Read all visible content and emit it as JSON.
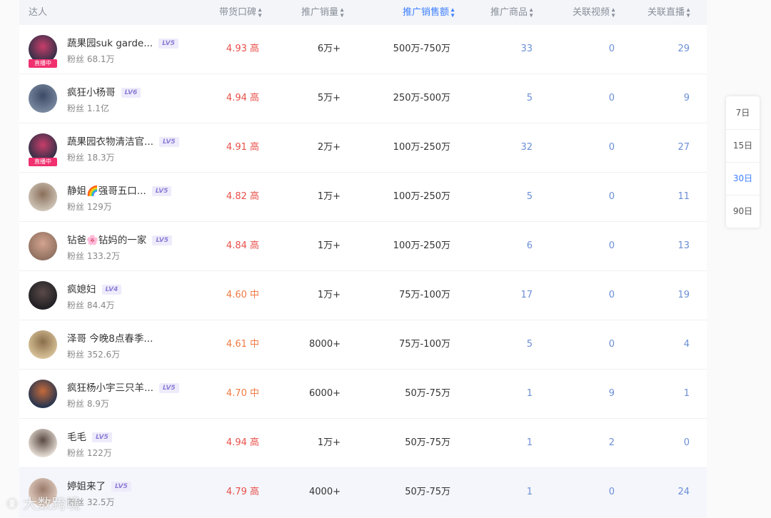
{
  "header": {
    "columns": [
      "达人",
      "带货口碑",
      "推广销量",
      "推广销售额",
      "推广商品",
      "关联视频",
      "关联直播"
    ]
  },
  "rows": [
    {
      "name": "蔬果园suk garde...",
      "level": "LV5",
      "fans": "粉丝 68.1万",
      "live": "直播中",
      "score": "4.93 高",
      "sales": "6万+",
      "revenue": "500万-750万",
      "products": "33",
      "videos": "0",
      "lives": "29"
    },
    {
      "name": "疯狂小杨哥",
      "level": "LV6",
      "fans": "粉丝 1.1亿",
      "live": "",
      "score": "4.94 高",
      "sales": "5万+",
      "revenue": "250万-500万",
      "products": "5",
      "videos": "0",
      "lives": "9"
    },
    {
      "name": "蔬果园衣物清洁官...",
      "level": "LV5",
      "fans": "粉丝 18.3万",
      "live": "直播中",
      "score": "4.91 高",
      "sales": "2万+",
      "revenue": "100万-250万",
      "products": "32",
      "videos": "0",
      "lives": "27"
    },
    {
      "name": "静姐🌈强哥五口...",
      "level": "LV5",
      "fans": "粉丝 129万",
      "live": "",
      "score": "4.82 高",
      "sales": "1万+",
      "revenue": "100万-250万",
      "products": "5",
      "videos": "0",
      "lives": "11"
    },
    {
      "name": "钻爸🌸钻妈的一家",
      "level": "LV5",
      "fans": "粉丝 133.2万",
      "live": "",
      "score": "4.84 高",
      "sales": "1万+",
      "revenue": "100万-250万",
      "products": "6",
      "videos": "0",
      "lives": "13"
    },
    {
      "name": "疯媳妇",
      "level": "LV4",
      "fans": "粉丝 84.4万",
      "live": "",
      "score": "4.60 中",
      "sales": "1万+",
      "revenue": "75万-100万",
      "products": "17",
      "videos": "0",
      "lives": "19"
    },
    {
      "name": "泽哥 今晚8点春季...",
      "level": "",
      "fans": "粉丝 352.6万",
      "live": "",
      "score": "4.61 中",
      "sales": "8000+",
      "revenue": "75万-100万",
      "products": "5",
      "videos": "0",
      "lives": "4"
    },
    {
      "name": "疯狂杨小宇三只羊...",
      "level": "LV5",
      "fans": "粉丝 8.9万",
      "live": "",
      "score": "4.70 中",
      "sales": "6000+",
      "revenue": "50万-75万",
      "products": "1",
      "videos": "9",
      "lives": "1"
    },
    {
      "name": "毛毛",
      "level": "LV5",
      "fans": "粉丝 122万",
      "live": "",
      "score": "4.94 高",
      "sales": "1万+",
      "revenue": "50万-75万",
      "products": "1",
      "videos": "2",
      "lives": "0"
    },
    {
      "name": "婷姐来了",
      "level": "LV5",
      "fans": "粉丝 32.5万",
      "live": "",
      "score": "4.79 高",
      "sales": "4000+",
      "revenue": "50万-75万",
      "products": "1",
      "videos": "0",
      "lives": "24"
    }
  ],
  "side_tabs": [
    "7日",
    "15日",
    "30日",
    "90日"
  ],
  "active_side_tab": "30日",
  "watermark": "大数跨境",
  "colors": {
    "accent": "#3d7fff",
    "score_high": "#e8504a",
    "score_mid": "#f07a43",
    "live_tag": "#f0306f"
  }
}
